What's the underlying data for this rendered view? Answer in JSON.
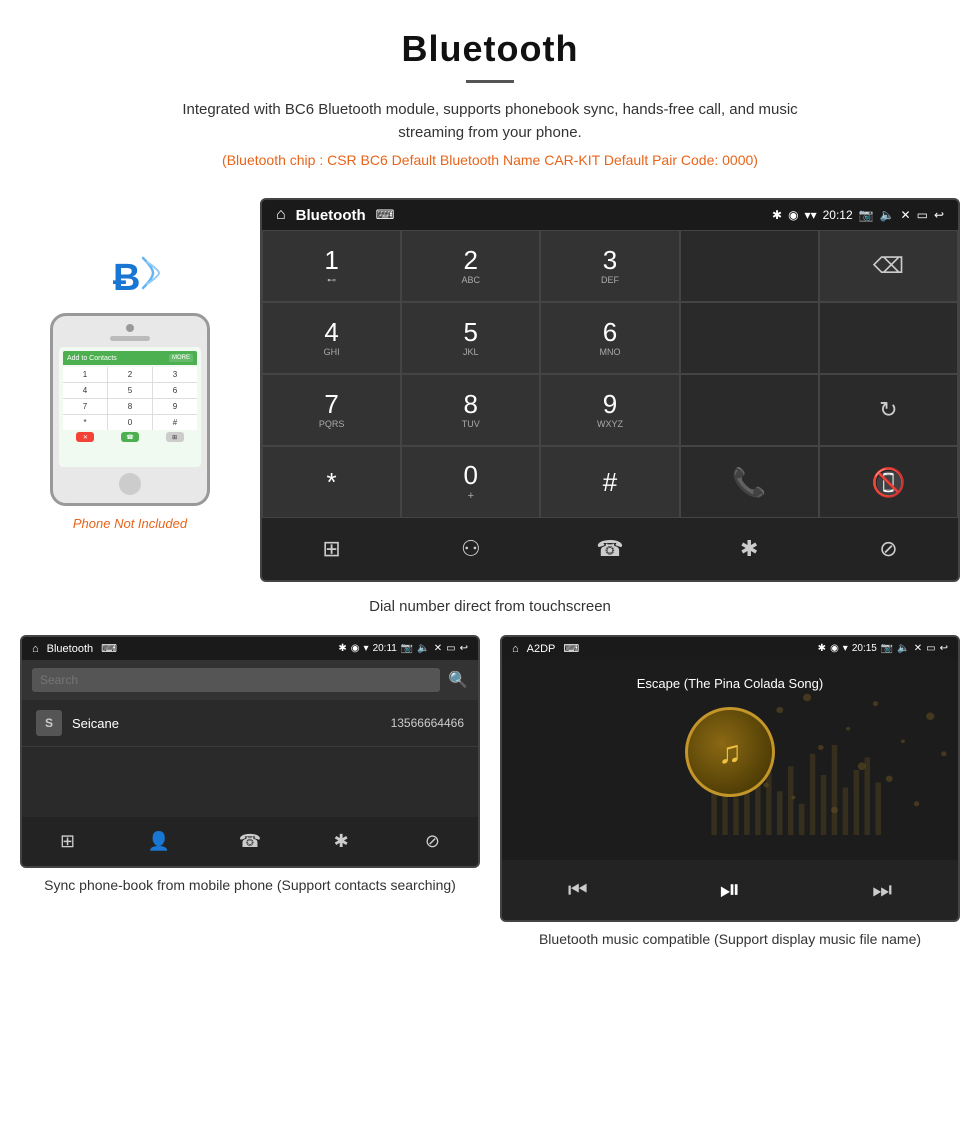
{
  "header": {
    "title": "Bluetooth",
    "divider": true,
    "description": "Integrated with BC6 Bluetooth module, supports phonebook sync, hands-free call, and music streaming from your phone.",
    "specs": "(Bluetooth chip : CSR BC6    Default Bluetooth Name CAR-KIT    Default Pair Code: 0000)"
  },
  "phone_label": "Phone Not Included",
  "main_screen": {
    "status_bar": {
      "title": "Bluetooth",
      "usb_symbol": "⌨",
      "time": "20:12",
      "icons": "✱ ◉ ▾"
    },
    "dialpad": {
      "keys": [
        {
          "num": "1",
          "sub": "⊷"
        },
        {
          "num": "2",
          "sub": "ABC"
        },
        {
          "num": "3",
          "sub": "DEF"
        },
        {
          "num": "backspace",
          "sub": ""
        },
        {
          "num": "4",
          "sub": "GHI"
        },
        {
          "num": "5",
          "sub": "JKL"
        },
        {
          "num": "6",
          "sub": "MNO"
        },
        {
          "num": "empty",
          "sub": ""
        },
        {
          "num": "7",
          "sub": "PQRS"
        },
        {
          "num": "8",
          "sub": "TUV"
        },
        {
          "num": "9",
          "sub": "WXYZ"
        },
        {
          "num": "refresh",
          "sub": ""
        },
        {
          "num": "*",
          "sub": ""
        },
        {
          "num": "0",
          "sub": "+"
        },
        {
          "num": "#",
          "sub": ""
        },
        {
          "num": "call_green",
          "sub": ""
        },
        {
          "num": "empty2",
          "sub": ""
        },
        {
          "num": "call_red",
          "sub": ""
        }
      ],
      "bottom_nav": [
        "⊞",
        "⚇",
        "☎",
        "✱",
        "⊘"
      ]
    }
  },
  "main_caption": "Dial number direct from touchscreen",
  "phonebook_screen": {
    "status_bar": {
      "title": "Bluetooth",
      "time": "20:11",
      "icons": "✱ ◉ ▾"
    },
    "search_placeholder": "Search",
    "contacts": [
      {
        "letter": "S",
        "name": "Seicane",
        "number": "13566664466"
      }
    ],
    "bottom_nav": [
      "⊞",
      "👤",
      "☎",
      "✱",
      "⊘"
    ]
  },
  "music_screen": {
    "status_bar": {
      "title": "A2DP",
      "time": "20:15",
      "icons": "✱ ◉ ▾"
    },
    "song_title": "Escape (The Pina Colada Song)",
    "controls": {
      "prev": "⏮",
      "play_pause": "⏯",
      "next": "⏭"
    }
  },
  "captions": {
    "phonebook": "Sync phone-book from mobile phone\n(Support contacts searching)",
    "music": "Bluetooth music compatible\n(Support display music file name)"
  },
  "watermark": "Seicane"
}
